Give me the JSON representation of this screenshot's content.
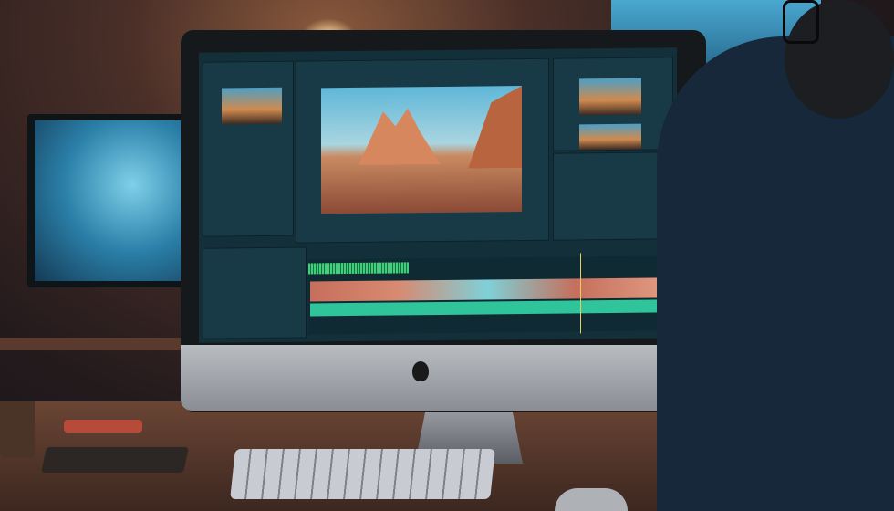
{
  "scene": {
    "subject": "video-editing-workstation"
  },
  "colors": {
    "ui_panel": "#173a46",
    "waveform": "#3fd07a",
    "audio_track": "#2fc49a",
    "playhead": "#e8d060"
  }
}
